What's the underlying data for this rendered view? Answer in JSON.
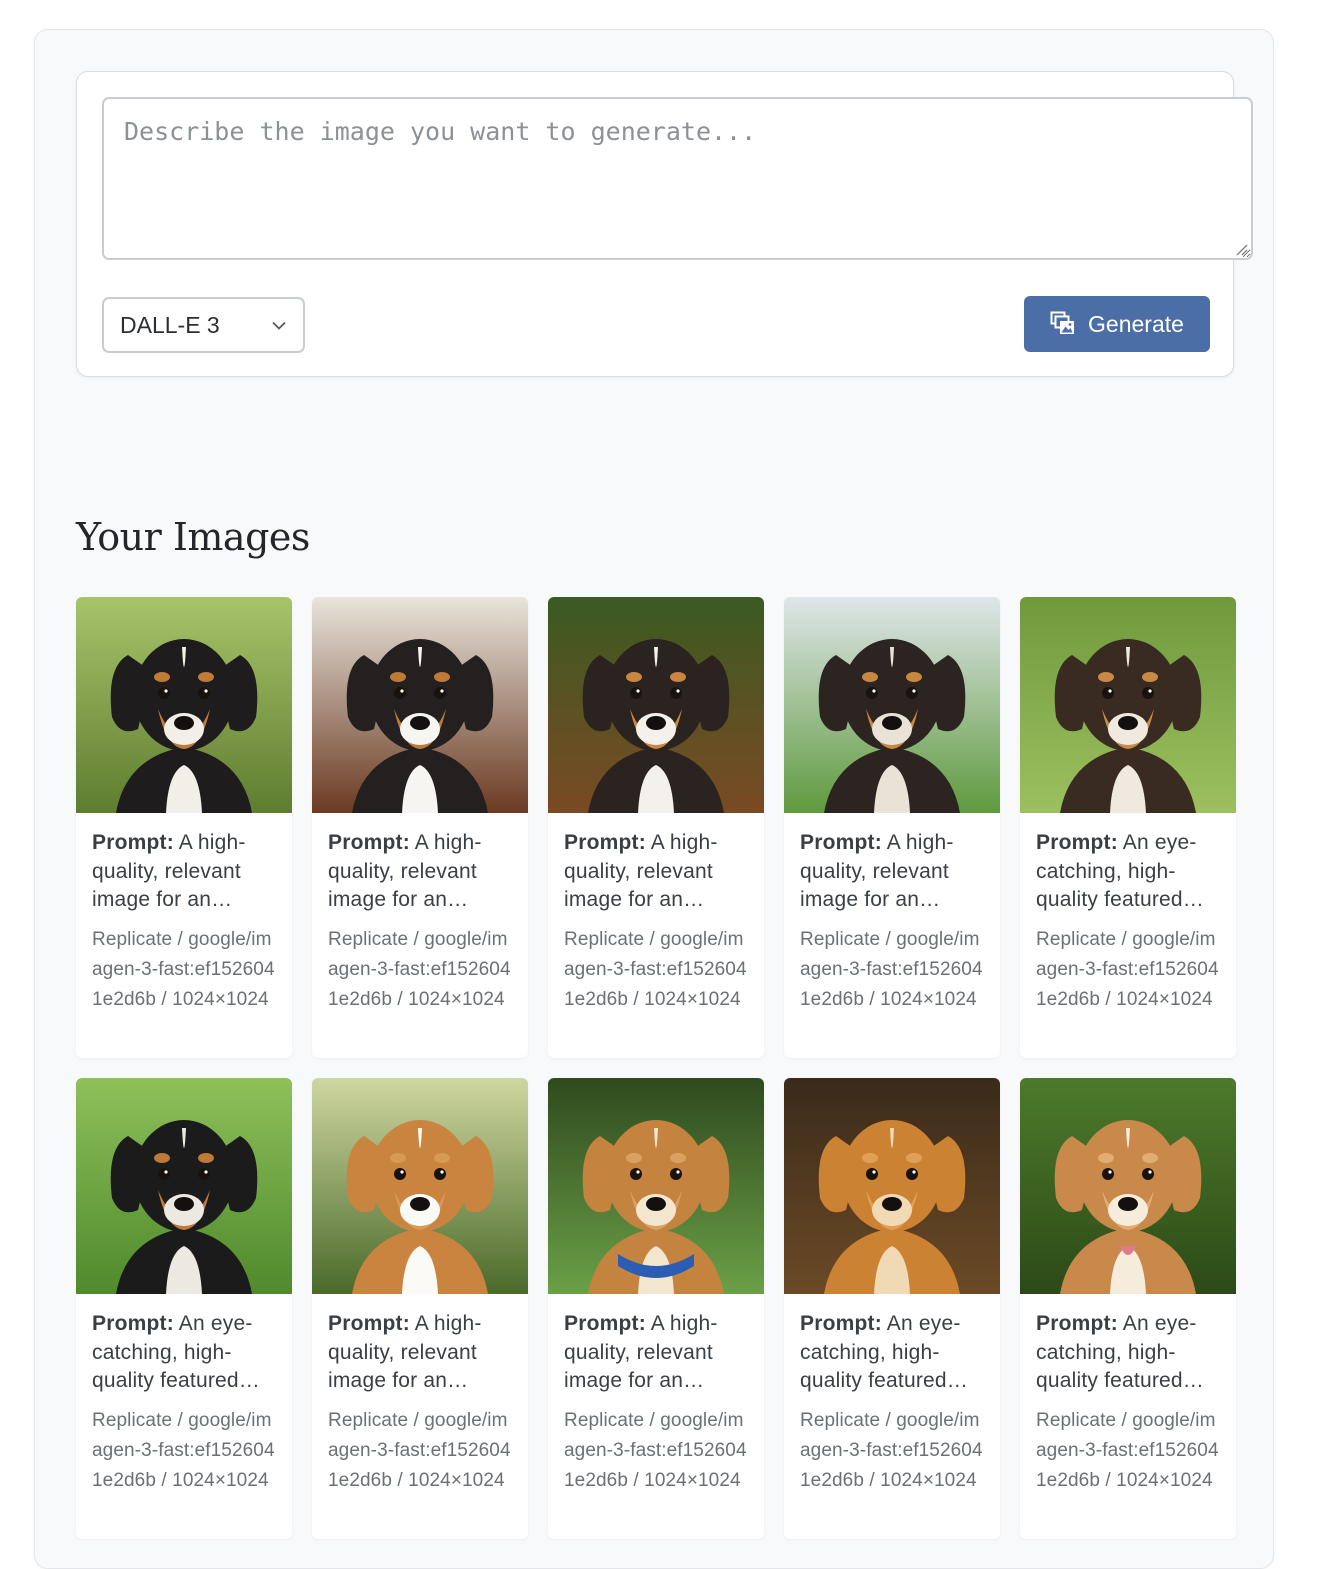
{
  "composer": {
    "prompt_placeholder": "Describe the image you want to generate...",
    "prompt_value": "",
    "model_selected": "DALL-E 3",
    "generate_label": "Generate"
  },
  "gallery": {
    "title": "Your Images",
    "prompt_prefix": "Prompt:",
    "items": [
      {
        "prompt": "A high-quality, relevant image for an…",
        "source": "Replicate",
        "model": "google/imagen-3-fast:ef1526041e2d6b",
        "size": "1024×1024",
        "bg": [
          "#a8c46a",
          "#5e7d30"
        ],
        "fur": "#1e1c1c",
        "tan": "#c07b35",
        "chest": "#f2efe9",
        "tongue": false,
        "collar": false
      },
      {
        "prompt": "A high-quality, relevant image for an…",
        "source": "Replicate",
        "model": "google/imagen-3-fast:ef1526041e2d6b",
        "size": "1024×1024",
        "bg": [
          "#e8e4dc",
          "#6b3a22"
        ],
        "fur": "#23201f",
        "tan": "#bf7a36",
        "chest": "#f7f5f1",
        "tongue": false,
        "collar": false
      },
      {
        "prompt": "A high-quality, relevant image for an…",
        "source": "Replicate",
        "model": "google/imagen-3-fast:ef1526041e2d6b",
        "size": "1024×1024",
        "bg": [
          "#3b5a22",
          "#7a4a24"
        ],
        "fur": "#2a2320",
        "tan": "#c8863f",
        "chest": "#f4f1ec",
        "tongue": false,
        "collar": false
      },
      {
        "prompt": "A high-quality, relevant image for an…",
        "source": "Replicate",
        "model": "google/imagen-3-fast:ef1526041e2d6b",
        "size": "1024×1024",
        "bg": [
          "#dfe6ea",
          "#5f9a3e"
        ],
        "fur": "#2c2420",
        "tan": "#c98840",
        "chest": "#e9e2d6",
        "tongue": false,
        "collar": false
      },
      {
        "prompt": "An eye-catching, high-quality featured…",
        "source": "Replicate",
        "model": "google/imagen-3-fast:ef1526041e2d6b",
        "size": "1024×1024",
        "bg": [
          "#6f9a3c",
          "#9cc060"
        ],
        "fur": "#3a2b22",
        "tan": "#c98a48",
        "chest": "#efe9df",
        "tongue": false,
        "collar": false
      },
      {
        "prompt": "An eye-catching, high-quality featured…",
        "source": "Replicate",
        "model": "google/imagen-3-fast:ef1526041e2d6b",
        "size": "1024×1024",
        "bg": [
          "#8fc05a",
          "#4f8a2c"
        ],
        "fur": "#1c1b1c",
        "tan": "#c07a38",
        "chest": "#ece8e2",
        "tongue": false,
        "collar": false
      },
      {
        "prompt": "A high-quality, relevant image for an…",
        "source": "Replicate",
        "model": "google/imagen-3-fast:ef1526041e2d6b",
        "size": "1024×1024",
        "bg": [
          "#cfd7a0",
          "#4a6a2a"
        ],
        "fur": "#c9843f",
        "tan": "#d99a55",
        "chest": "#fbfaf7",
        "tongue": false,
        "collar": false
      },
      {
        "prompt": "A high-quality, relevant image for an…",
        "source": "Replicate",
        "model": "google/imagen-3-fast:ef1526041e2d6b",
        "size": "1024×1024",
        "bg": [
          "#2f4a1e",
          "#6aa047"
        ],
        "fur": "#c4833f",
        "tan": "#dca062",
        "chest": "#f3e6cf",
        "tongue": false,
        "collar": true
      },
      {
        "prompt": "An eye-catching, high-quality featured…",
        "source": "Replicate",
        "model": "google/imagen-3-fast:ef1526041e2d6b",
        "size": "1024×1024",
        "bg": [
          "#3a2a1a",
          "#6b4a26"
        ],
        "fur": "#cc8233",
        "tan": "#e0a056",
        "chest": "#f0d9b5",
        "tongue": false,
        "collar": false
      },
      {
        "prompt": "An eye-catching, high-quality featured…",
        "source": "Replicate",
        "model": "google/imagen-3-fast:ef1526041e2d6b",
        "size": "1024×1024",
        "bg": [
          "#4d7a2a",
          "#2c4a18"
        ],
        "fur": "#c8894a",
        "tan": "#e2ad72",
        "chest": "#f6ecdc",
        "tongue": true,
        "collar": false
      }
    ]
  },
  "colors": {
    "accent": "#4b6ea6",
    "panel_bg": "#f8f9fa",
    "border": "#c9ccd1"
  },
  "icons": {
    "generate": "images-stack-icon",
    "select": "chevron-down-icon",
    "textarea": "resize-grip-icon"
  }
}
